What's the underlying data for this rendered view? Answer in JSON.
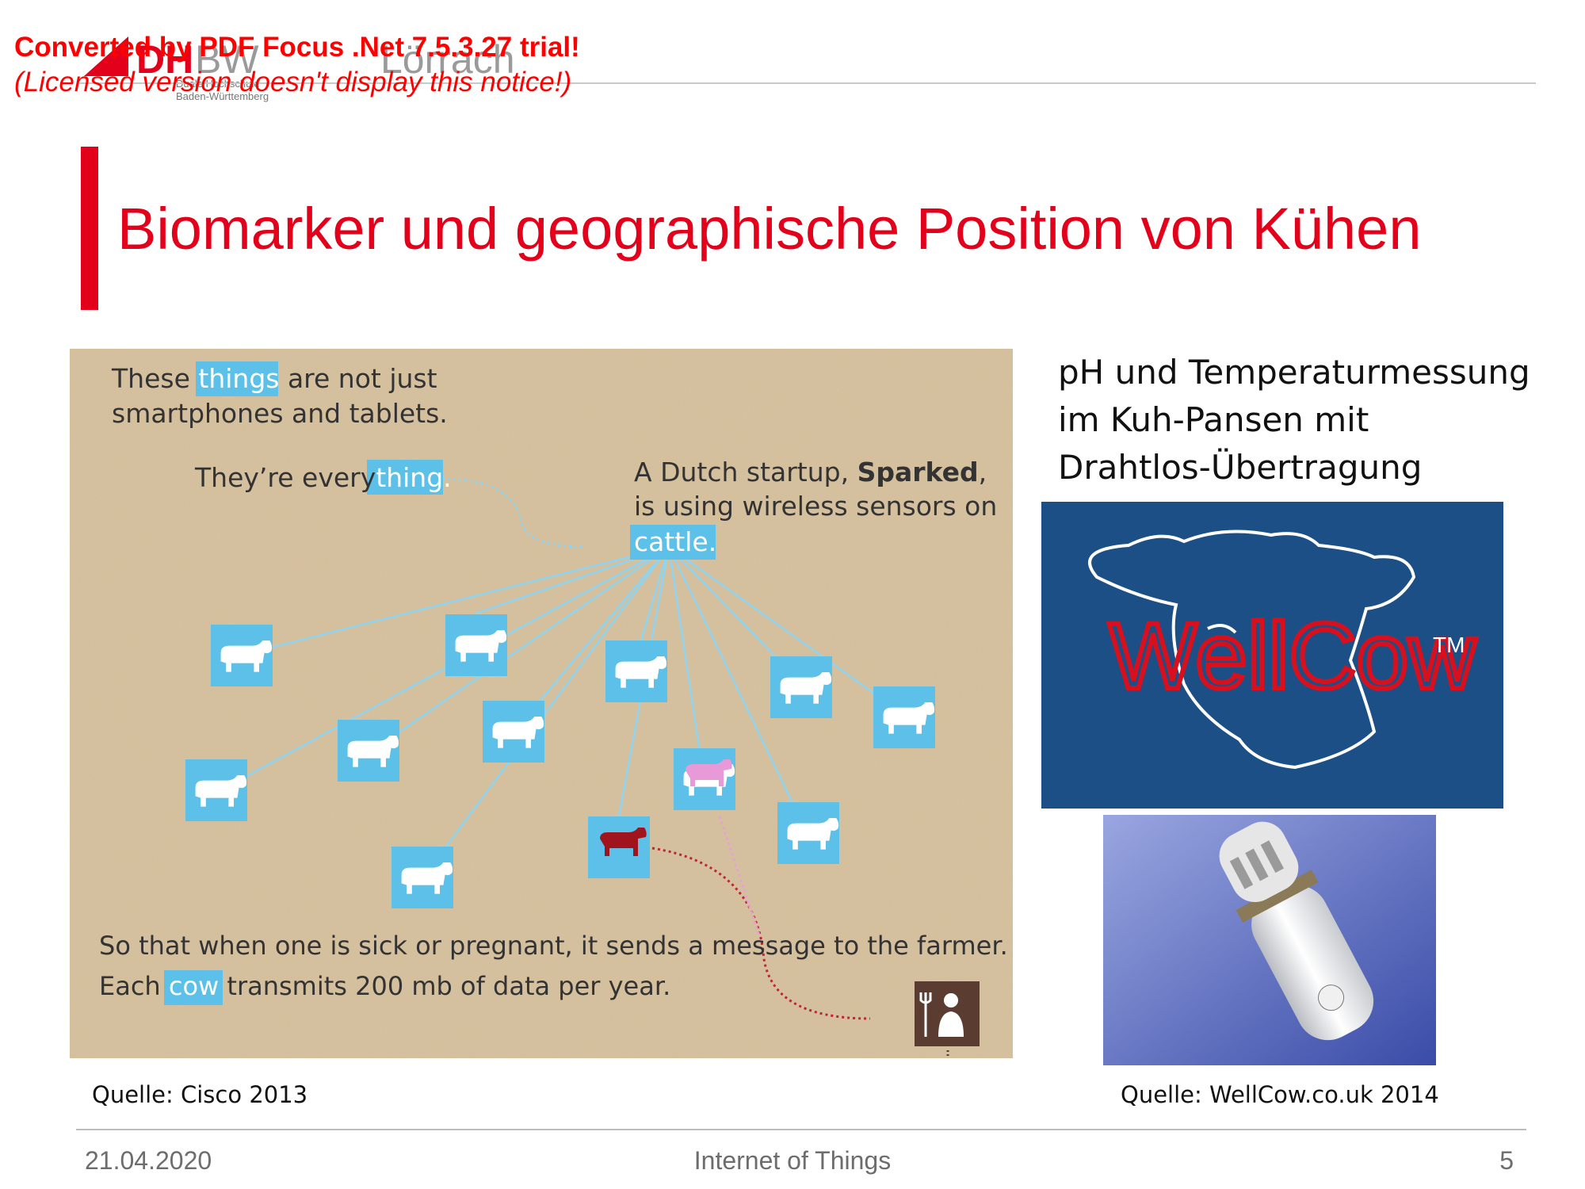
{
  "header": {
    "logo_text": "DHBW Lörrach",
    "logo_subtitle": "Duale Hochschule Baden-Württemberg",
    "trial_line1": "Converted by PDF Focus .Net 7.5.3.27 trial!",
    "trial_line2": "(Licensed version doesn't display this notice!)"
  },
  "slide": {
    "title": "Biomarker und geographische Position von Kühen"
  },
  "left_figure": {
    "line1_pre": "These ",
    "line1_hl": "things",
    "line1_post": " are not just",
    "line2": "smartphones and tablets.",
    "line3_pre": "They’re every",
    "line3_hl": "thing.",
    "dutch1_pre": "A Dutch startup, ",
    "dutch1_bold": "Sparked",
    "dutch1_post": ",",
    "dutch2": "is using wireless sensors on",
    "dutch3_hl": "cattle.",
    "bottom1": "So that when one is sick or pregnant, it sends a message to the farmer.",
    "bottom2_pre": "Each ",
    "bottom2_hl": "cow",
    "bottom2_post": " transmits 200 mb of data per year.",
    "caption": "Quelle: Cisco 2013"
  },
  "right_panel": {
    "text_line1": "pH und Temperaturmessung",
    "text_line2": "im Kuh-Pansen mit",
    "text_line3": "Drahtlos-Übertragung",
    "wellcow_logo_text": "WellCow",
    "tm": "TM",
    "caption": "Quelle: WellCow.co.uk 2014"
  },
  "footer": {
    "date": "21.04.2020",
    "center": "Internet of Things",
    "page": "5"
  },
  "colors": {
    "accent_red": "#e2001a",
    "highlight_blue": "#5cc0e8",
    "wellcow_bg": "#1b4f86"
  }
}
